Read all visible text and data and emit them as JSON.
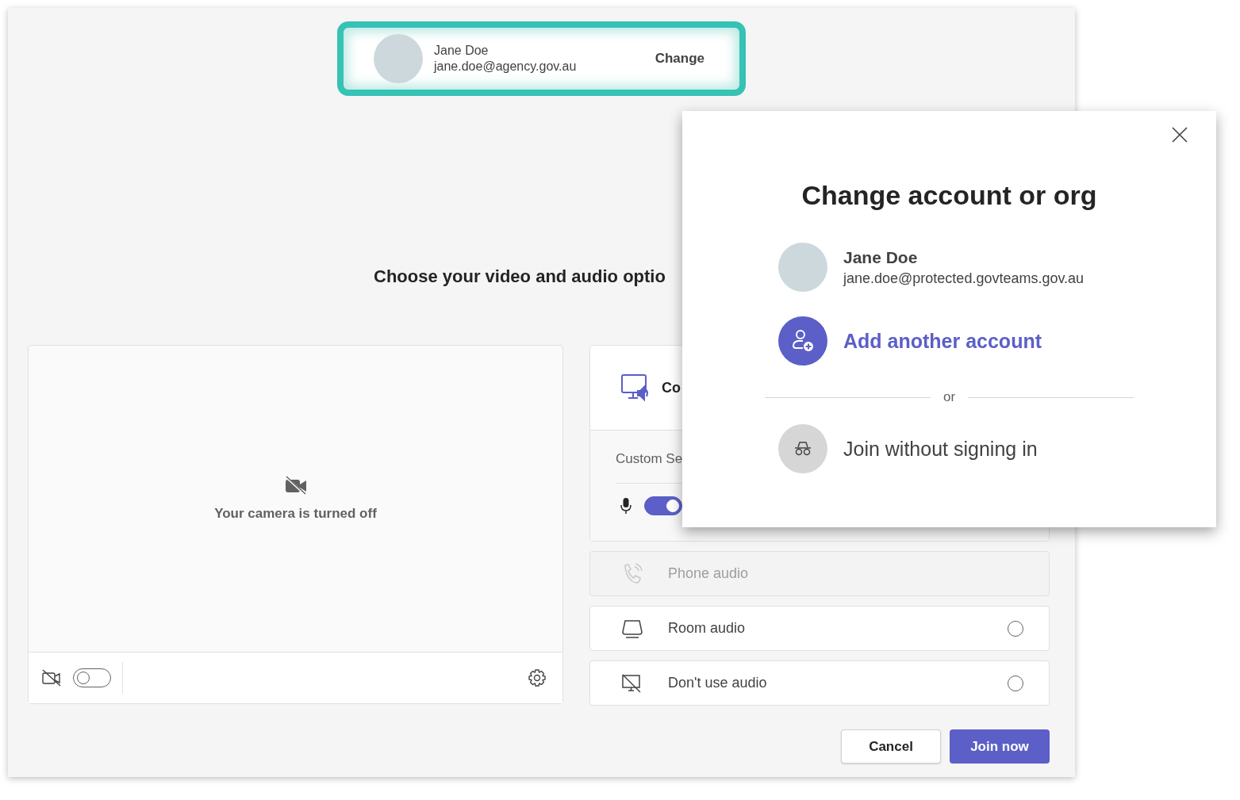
{
  "account_card": {
    "name": "Jane Doe",
    "email": "jane.doe@agency.gov.au",
    "action": "Change",
    "highlighted": true
  },
  "heading": "Choose your video and audio optio",
  "camera": {
    "message": "Your camera is turned off",
    "on": false
  },
  "computer_audio": {
    "label": "Co",
    "setting": "Custom Se",
    "mic_on": true
  },
  "audio_options": [
    {
      "kind": "phone",
      "label": "Phone audio",
      "disabled": true
    },
    {
      "kind": "room",
      "label": "Room audio",
      "disabled": false,
      "selected": false
    },
    {
      "kind": "none",
      "label": "Don't use audio",
      "disabled": false,
      "selected": false
    }
  ],
  "buttons": [
    {
      "kind": "secondary",
      "label": "Cancel"
    },
    {
      "kind": "primary",
      "label": "Join now"
    }
  ],
  "dialog": {
    "title": "Change account or org",
    "account": {
      "name": "Jane Doe",
      "email": "jane.doe@protected.govteams.gov.au"
    },
    "add_account": "Add another account",
    "separator": "or",
    "guest": "Join without signing in"
  }
}
